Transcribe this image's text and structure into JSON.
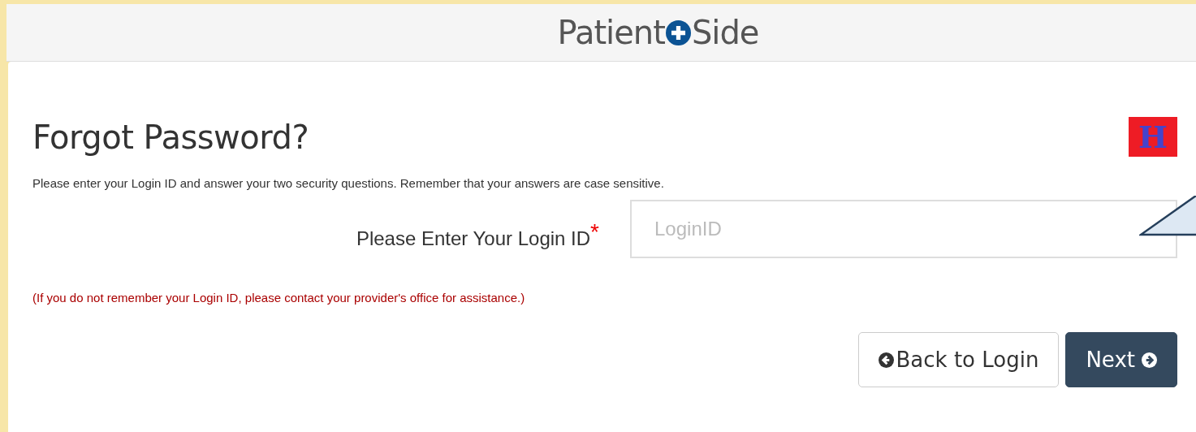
{
  "header": {
    "logo_left": "Patient",
    "logo_right": "Side"
  },
  "form": {
    "title": "Forgot Password?",
    "badge": "H",
    "instructions": "Please enter your Login ID and answer your two security questions. Remember that your answers are case sensitive.",
    "login_label": "Please Enter Your Login ID",
    "required_mark": "*",
    "login_placeholder": "LoginID",
    "note": "(If you do not remember your Login ID, please contact your provider's office for assistance.)",
    "buttons": [
      {
        "kind": "back",
        "label": "Back to Login"
      },
      {
        "kind": "next",
        "label": "Next"
      }
    ]
  }
}
